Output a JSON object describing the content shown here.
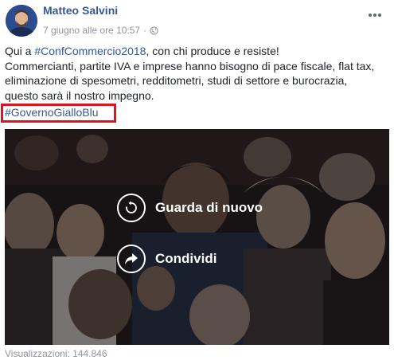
{
  "post": {
    "author": "Matteo Salvini",
    "timestamp": "7 giugno alle ore 10:57",
    "separator": "·",
    "privacy_icon": "globe-icon",
    "menu_icon": "more-options-icon",
    "text": {
      "line1_prefix": "Qui a ",
      "line1_link": "#ConfCommercio2018",
      "line1_suffix": ", con chi produce e resiste!",
      "line2": "Commercianti, partite IVA e imprese hanno bisogno di pace fiscale, flat tax,",
      "line3": "eliminazione di spesometri, redditometri, studi di settore e burocrazia,",
      "line4": "questo sarà il nostro impegno.",
      "hashtag": "#GovernoGialloBlu"
    },
    "highlight_color": "#e0141e"
  },
  "video": {
    "replay_label": "Guarda di nuovo",
    "replay_icon": "replay-icon",
    "share_label": "Condividi",
    "share_icon": "share-icon"
  },
  "footer": {
    "views": "Visualizzazioni: 144.846"
  },
  "colors": {
    "link": "#365899",
    "meta": "#90949c",
    "text": "#1d2129"
  }
}
